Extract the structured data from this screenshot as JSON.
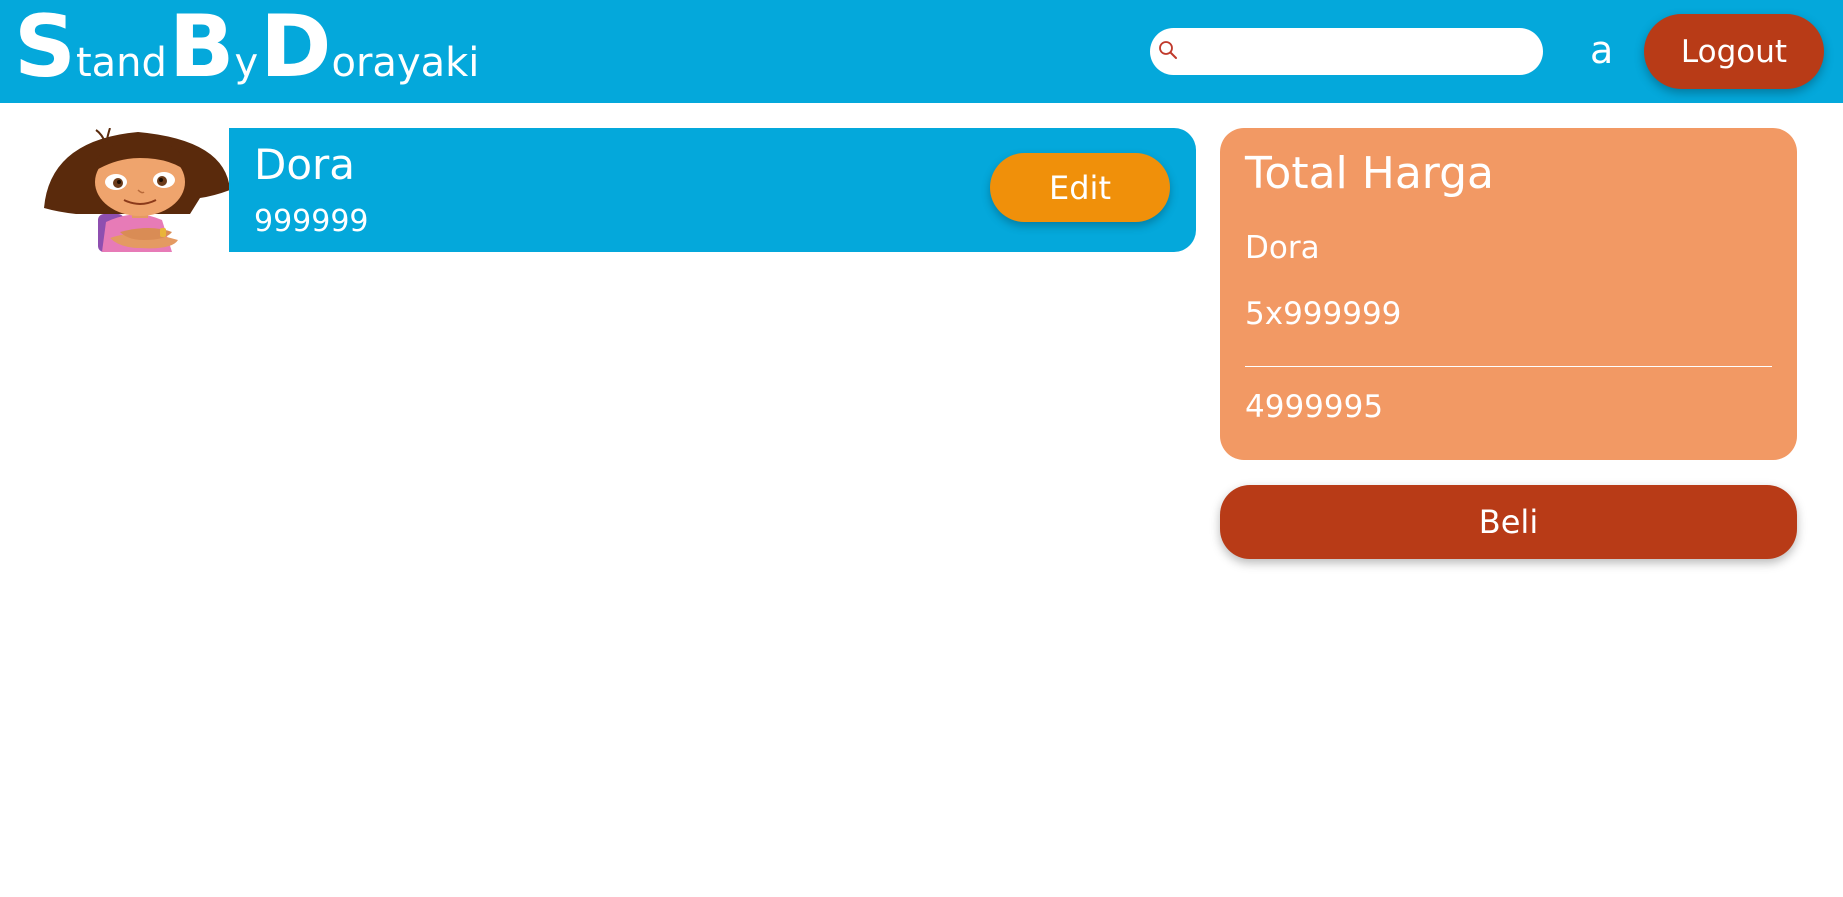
{
  "header": {
    "logo_parts": [
      {
        "text": "S",
        "size": "big"
      },
      {
        "text": "tand",
        "size": "small"
      },
      {
        "text": "B",
        "size": "big"
      },
      {
        "text": "y",
        "size": "small"
      },
      {
        "text": "D",
        "size": "big"
      },
      {
        "text": "orayaki",
        "size": "small"
      }
    ],
    "search": {
      "value": "",
      "placeholder": "",
      "icon": "search-icon"
    },
    "username": "a",
    "logout_label": "Logout"
  },
  "cart": {
    "items": [
      {
        "name": "Dora",
        "price": "999999",
        "edit_label": "Edit",
        "image_icon": "dora-character-image"
      }
    ]
  },
  "summary": {
    "title": "Total Harga",
    "item_name": "Dora",
    "quantity_line": "5x999999",
    "total": "4999995",
    "buy_label": "Beli"
  },
  "colors": {
    "navbar": "#04a8db",
    "logout": "#b83b17",
    "edit": "#f0900a",
    "summary_panel": "#f29964",
    "buy": "#b83b17"
  }
}
